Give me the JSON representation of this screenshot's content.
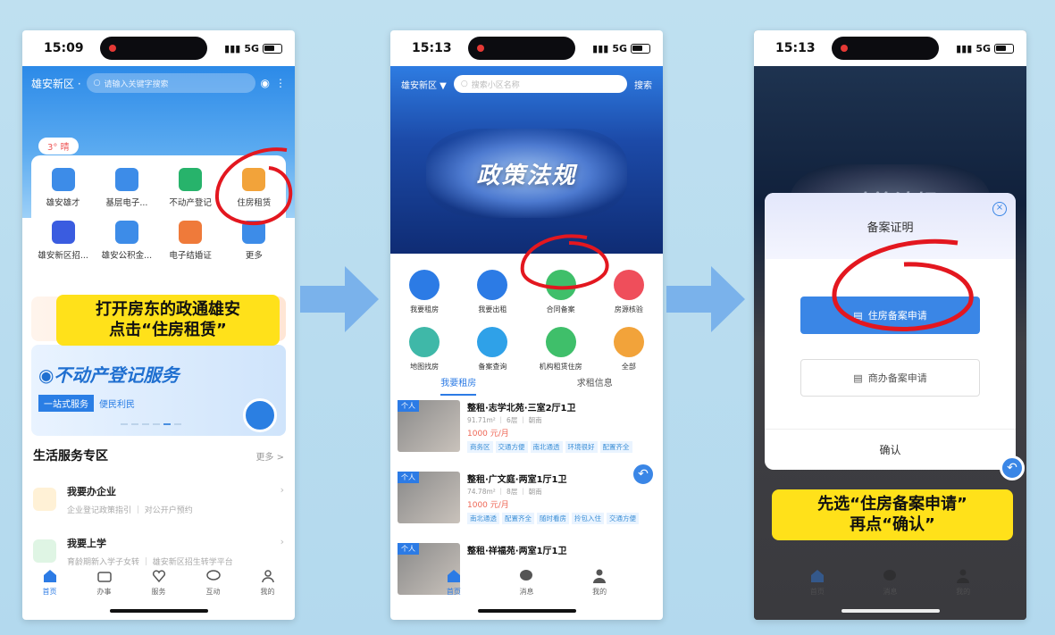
{
  "phone1": {
    "time": "15:09",
    "signal": "5G",
    "region": "雄安新区",
    "search_placeholder": "请输入关键字搜索",
    "weather": "3° 晴",
    "grid": [
      {
        "label": "雄安雄才",
        "color": "#3d8ce8"
      },
      {
        "label": "基层电子...",
        "color": "#3d8ce8"
      },
      {
        "label": "不动产登记",
        "color": "#27b36b"
      },
      {
        "label": "住房租赁",
        "color": "#f2a33a"
      },
      {
        "label": "雄安新区招...",
        "color": "#3a5ce0"
      },
      {
        "label": "雄安公积金...",
        "color": "#3d8ce8"
      },
      {
        "label": "电子结婚证",
        "color": "#ef7a3a"
      },
      {
        "label": "更多",
        "color": "#3d8ce8"
      }
    ],
    "banner_title": "不动产登记服务",
    "banner_tag": "一站式服务",
    "banner_tag2": "便民利民",
    "section_title": "生活服务专区",
    "section_more": "更多 >",
    "services": [
      {
        "title": "我要办企业",
        "sub": "企业登记政策指引  ｜  对公开户预约"
      },
      {
        "title": "我要上学",
        "sub": "育龄期新入学子女转 ｜ 雄安新区招生转学平台"
      }
    ],
    "tabs": [
      "首页",
      "办事",
      "服务",
      "互动",
      "我的"
    ],
    "callout": "打开房东的政通雄安\n点击“住房租赁”"
  },
  "phone2": {
    "time": "15:13",
    "signal": "5G",
    "region": "雄安新区",
    "search_placeholder": "搜索小区名称",
    "search_btn": "搜索",
    "banner": "政策法规",
    "grid": [
      {
        "label": "我要租房",
        "color": "#2c7be5"
      },
      {
        "label": "我要出租",
        "color": "#2c7be5"
      },
      {
        "label": "合同备案",
        "color": "#3fbf6a"
      },
      {
        "label": "房源核验",
        "color": "#ef4e5b"
      },
      {
        "label": "地图找房",
        "color": "#3fb8a8"
      },
      {
        "label": "备案查询",
        "color": "#2fa1e8"
      },
      {
        "label": "机构租赁住房",
        "color": "#3fbf6a"
      },
      {
        "label": "全部",
        "color": "#f2a33a"
      }
    ],
    "tabs": [
      "我要租房",
      "求租信息"
    ],
    "listings": [
      {
        "badge": "个人",
        "title": "整租·志学北苑·三室2厅1卫",
        "meta": "91.71m² ｜ 6层 ｜ 朝南",
        "price": "1000 元/月",
        "tags": [
          "商务区",
          "交通方便",
          "南北通透",
          "环境很好",
          "配置齐全"
        ]
      },
      {
        "badge": "个人",
        "title": "整租·广文庭·两室1厅1卫",
        "meta": "74.78m² ｜ 8层 ｜ 朝南",
        "price": "1000 元/月",
        "tags": [
          "南北通透",
          "配置齐全",
          "随时看房",
          "拎包入住",
          "交通方便"
        ]
      },
      {
        "badge": "个人",
        "title": "整租·祥福苑·两室1厅1卫",
        "meta": "",
        "price": "",
        "tags": []
      }
    ],
    "bottom_tabs": [
      "首页",
      "消息",
      "我的"
    ]
  },
  "phone3": {
    "time": "15:13",
    "signal": "5G",
    "banner": "政策法规",
    "dialog_title": "备案证明",
    "primary_btn": "住房备案申请",
    "secondary_btn": "商办备案申请",
    "confirm": "确认",
    "callout": "先选“住房备案申请”\n再点“确认”",
    "bottom_tabs": [
      "首页",
      "消息",
      "我的"
    ]
  }
}
